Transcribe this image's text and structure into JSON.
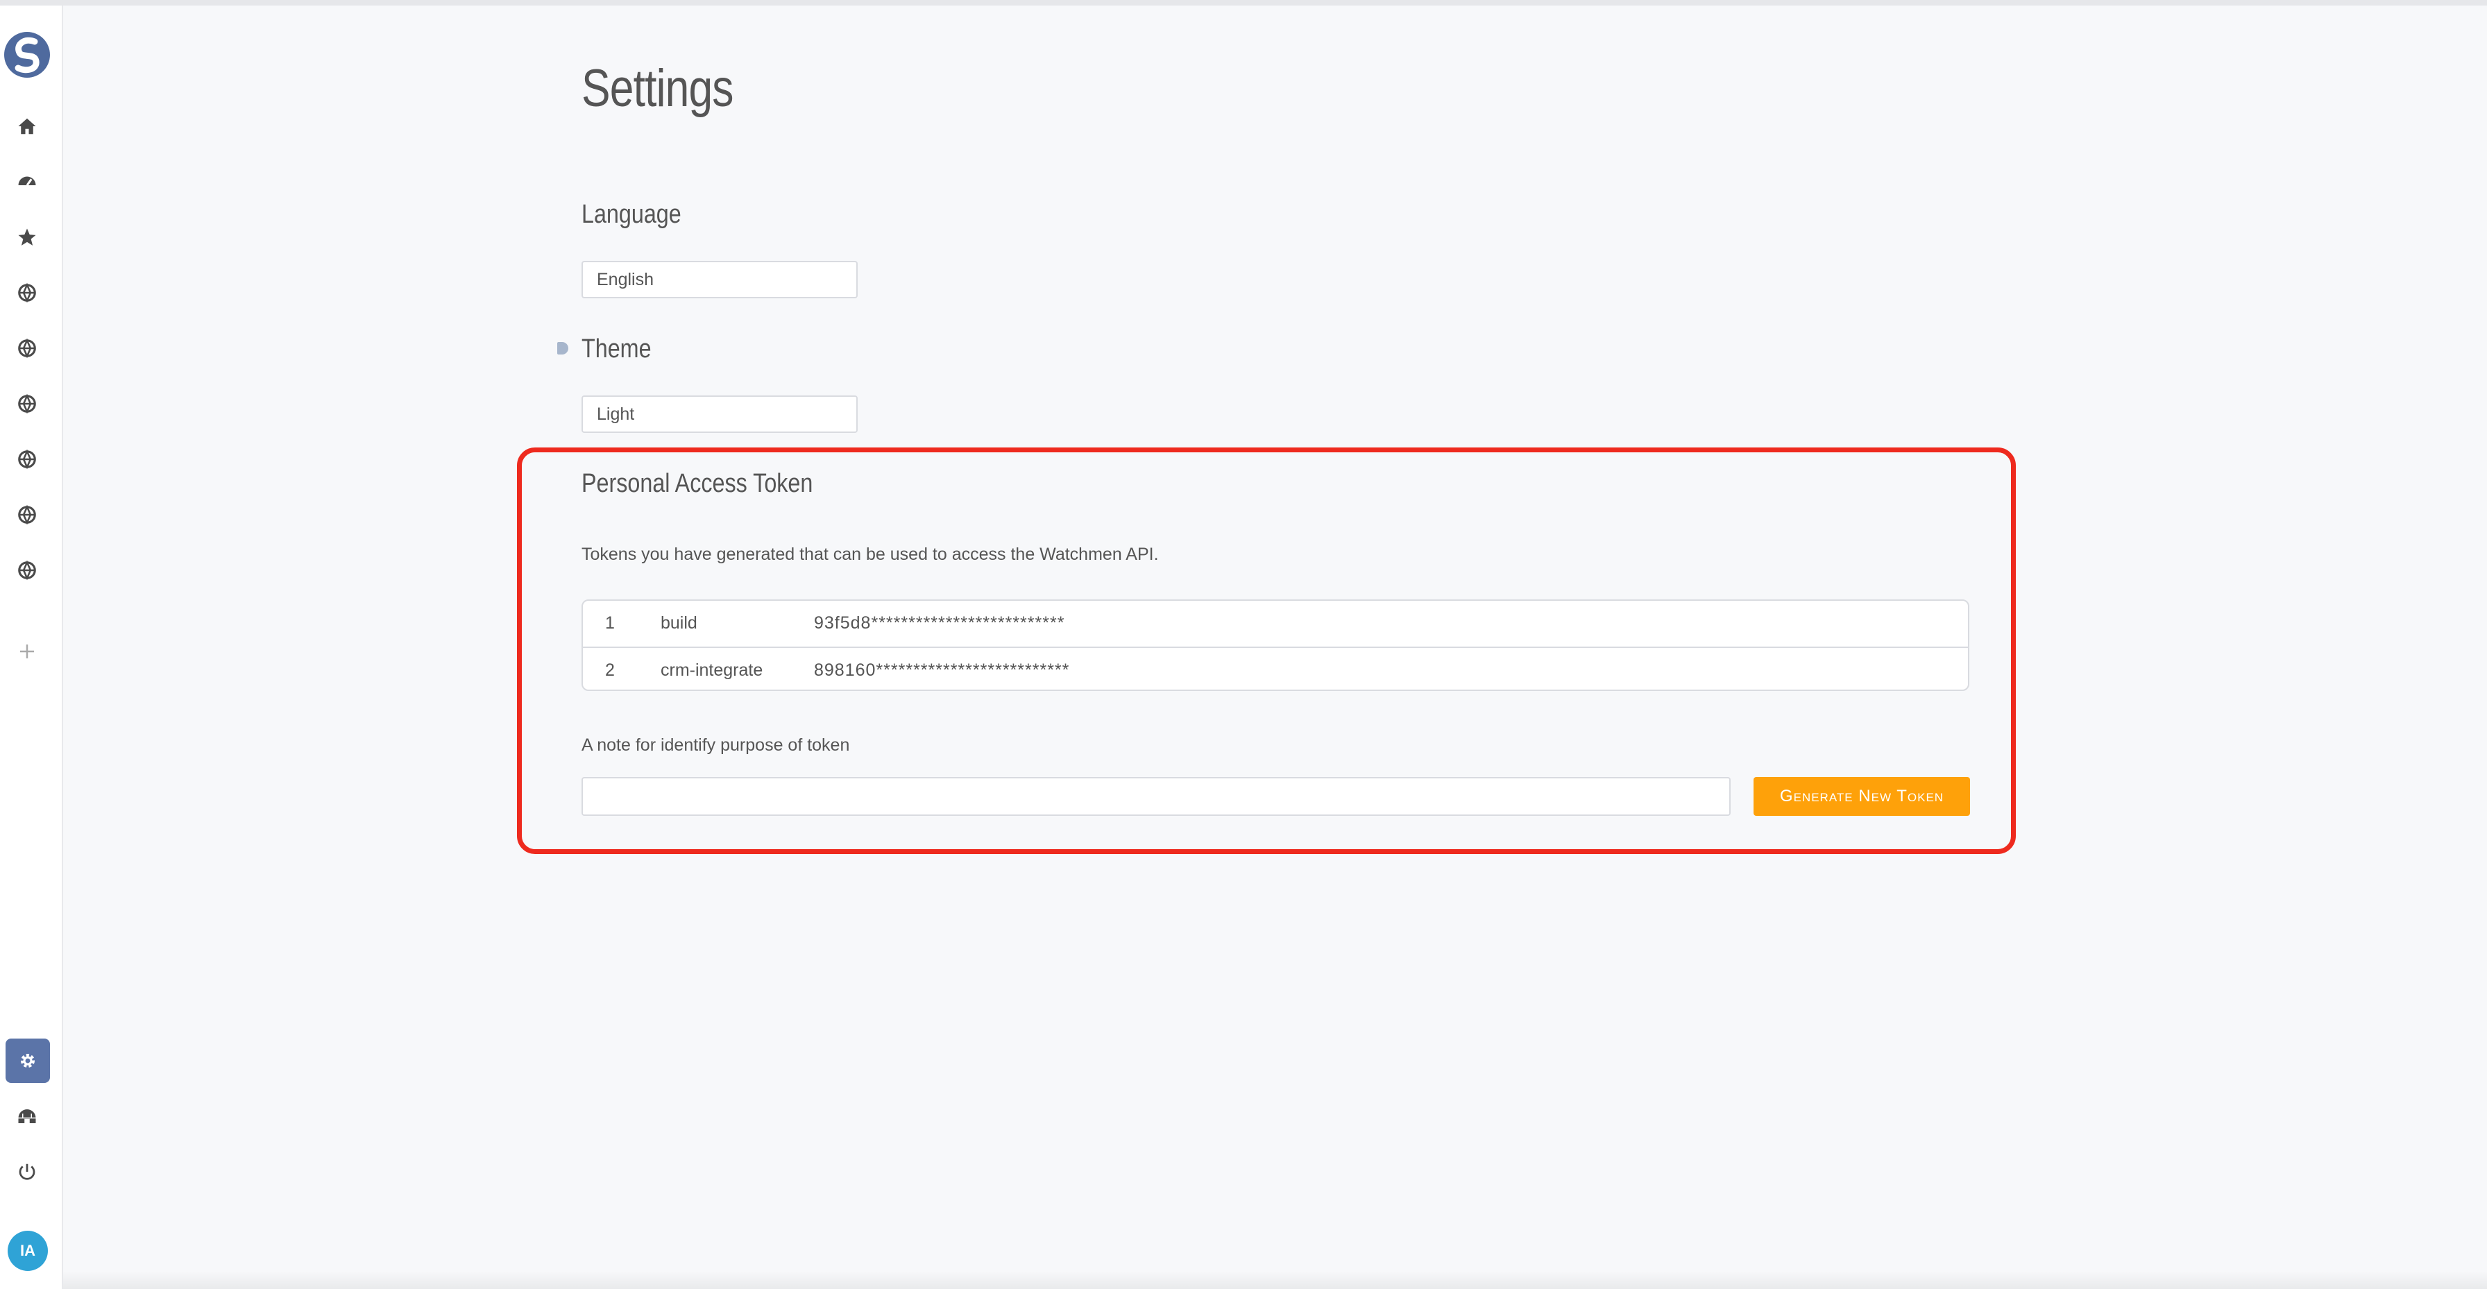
{
  "page": {
    "title": "Settings"
  },
  "sidebar": {
    "logo_icon": "s-logo-icon",
    "items": [
      {
        "name": "home",
        "icon": "home-icon"
      },
      {
        "name": "dashboard",
        "icon": "gauge-icon"
      },
      {
        "name": "favorites",
        "icon": "star-icon"
      },
      {
        "name": "space-1",
        "icon": "globe-icon"
      },
      {
        "name": "space-2",
        "icon": "globe-icon"
      },
      {
        "name": "space-3",
        "icon": "globe-icon"
      },
      {
        "name": "space-4",
        "icon": "globe-icon"
      },
      {
        "name": "space-5",
        "icon": "globe-icon"
      },
      {
        "name": "space-6",
        "icon": "globe-icon"
      },
      {
        "name": "add",
        "icon": "plus-icon"
      }
    ],
    "bottom": {
      "settings_icon": "gear-icon",
      "admin_icon": "igloo-icon",
      "logout_icon": "power-icon",
      "avatar_text": "IA"
    },
    "active_color": "#5b74a8"
  },
  "language": {
    "heading": "Language",
    "value": "English"
  },
  "theme": {
    "heading": "Theme",
    "value": "Light"
  },
  "tokens": {
    "heading": "Personal Access Token",
    "description": "Tokens you have generated that can be used to access the Watchmen API.",
    "rows": [
      {
        "index": "1",
        "note": "build",
        "token": "93f5d8**************************"
      },
      {
        "index": "2",
        "note": "crm-integrate",
        "token": "898160**************************"
      }
    ],
    "note_label": "A note for identify purpose of token",
    "note_value": "",
    "generate_label": "Generate New Token"
  },
  "colors": {
    "accent": "#fea10a",
    "highlight": "#ee2a1e",
    "avatar": "#2fa3d6"
  }
}
